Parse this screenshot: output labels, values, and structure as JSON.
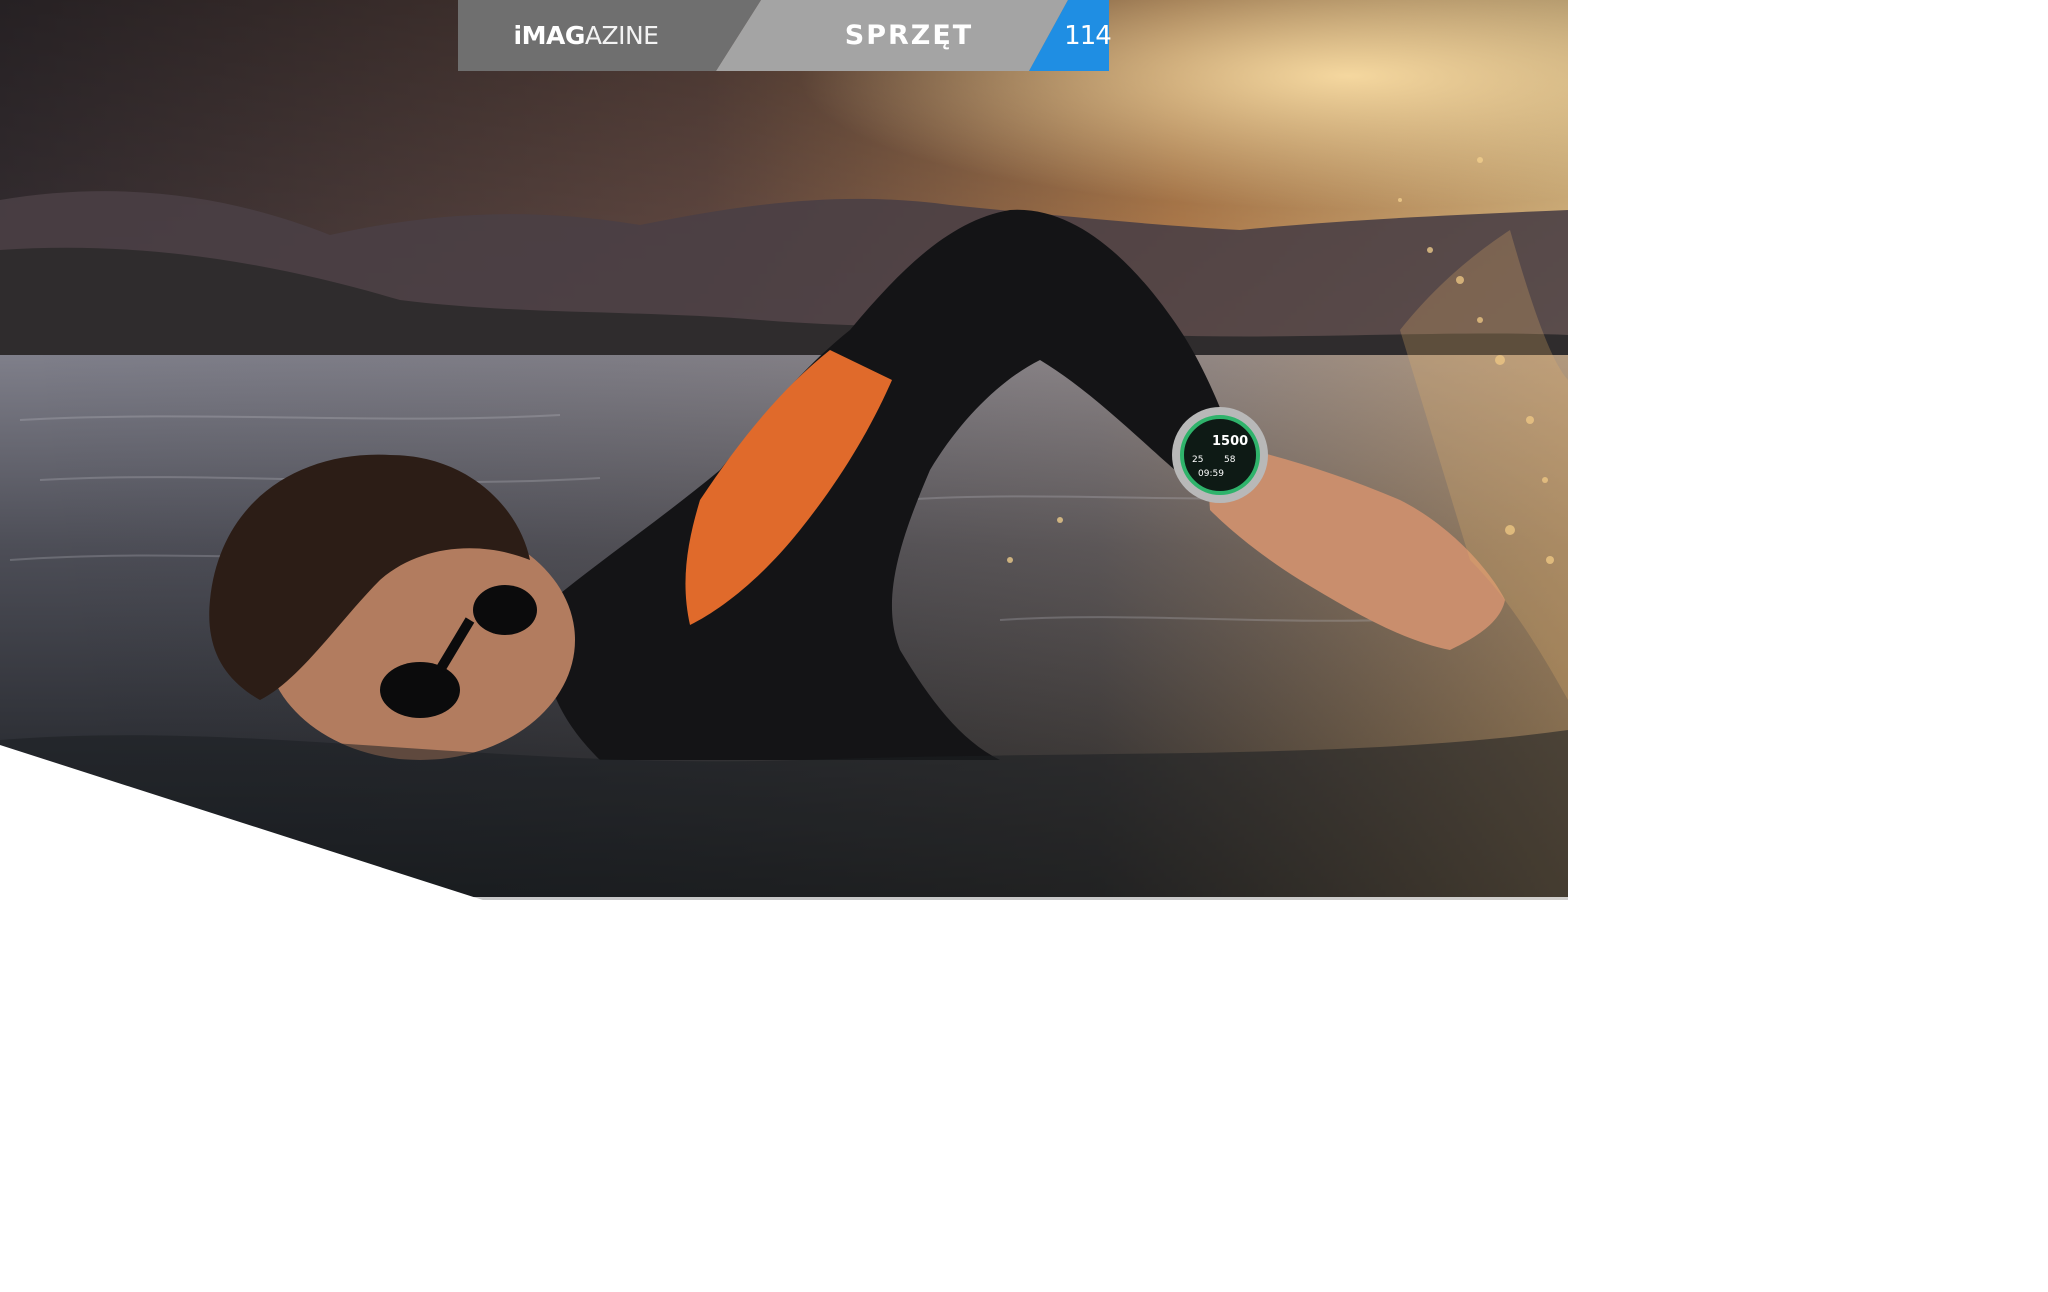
{
  "header": {
    "brand_name": "iMAGAZINE",
    "brand_letters": {
      "dot": "i",
      "bold": "MAG",
      "thin": "AZINE"
    },
    "section_label": "SPRZĘT",
    "page_number": "114",
    "colors": {
      "brand_bg": "#6f6f6f",
      "section_bg": "#a4a4a4",
      "page_number_bg": "#1f8ee3"
    }
  },
  "photo": {
    "watch_display": {
      "distance": "1500",
      "value_left": "25",
      "value_right": "58",
      "time": "09:59"
    }
  }
}
